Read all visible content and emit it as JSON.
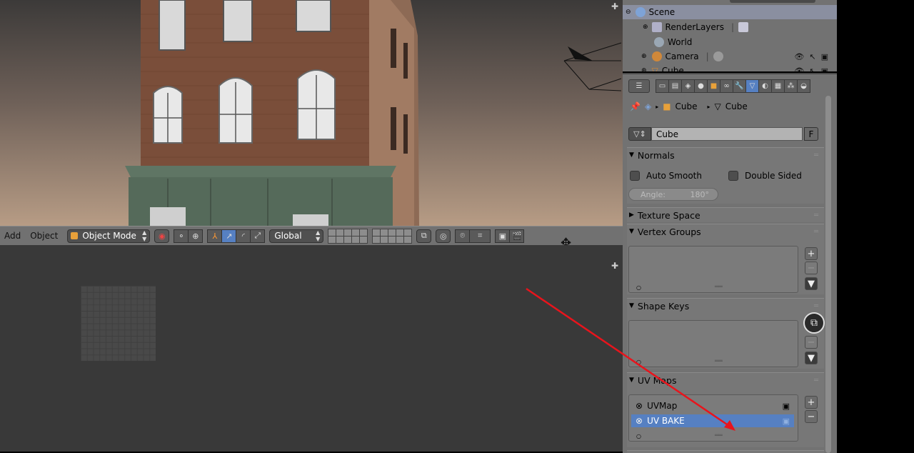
{
  "viewport": {
    "menu_add": "Add",
    "menu_object": "Object",
    "mode": "Object Mode",
    "orientation": "Global"
  },
  "outliner": {
    "rows": [
      {
        "label": "Scene"
      },
      {
        "label": "RenderLayers"
      },
      {
        "label": "World"
      },
      {
        "label": "Camera"
      },
      {
        "label": "Cube"
      }
    ]
  },
  "properties": {
    "breadcrumb": {
      "object": "Cube",
      "mesh": "Cube"
    },
    "mesh_name": "Cube",
    "fake_user": "F",
    "panels": {
      "normals": {
        "title": "Normals",
        "auto_smooth": "Auto Smooth",
        "double_sided": "Double Sided",
        "angle_label": "Angle:",
        "angle_value": "180°"
      },
      "texture_space": {
        "title": "Texture Space"
      },
      "vertex_groups": {
        "title": "Vertex Groups"
      },
      "shape_keys": {
        "title": "Shape Keys"
      },
      "uv_maps": {
        "title": "UV Maps",
        "items": [
          {
            "label": "UVMap",
            "selected": false
          },
          {
            "label": "UV BAKE",
            "selected": true
          }
        ]
      }
    }
  },
  "colors": {
    "accent": "#5680c2",
    "annotation_arrow": "#e8141c"
  }
}
